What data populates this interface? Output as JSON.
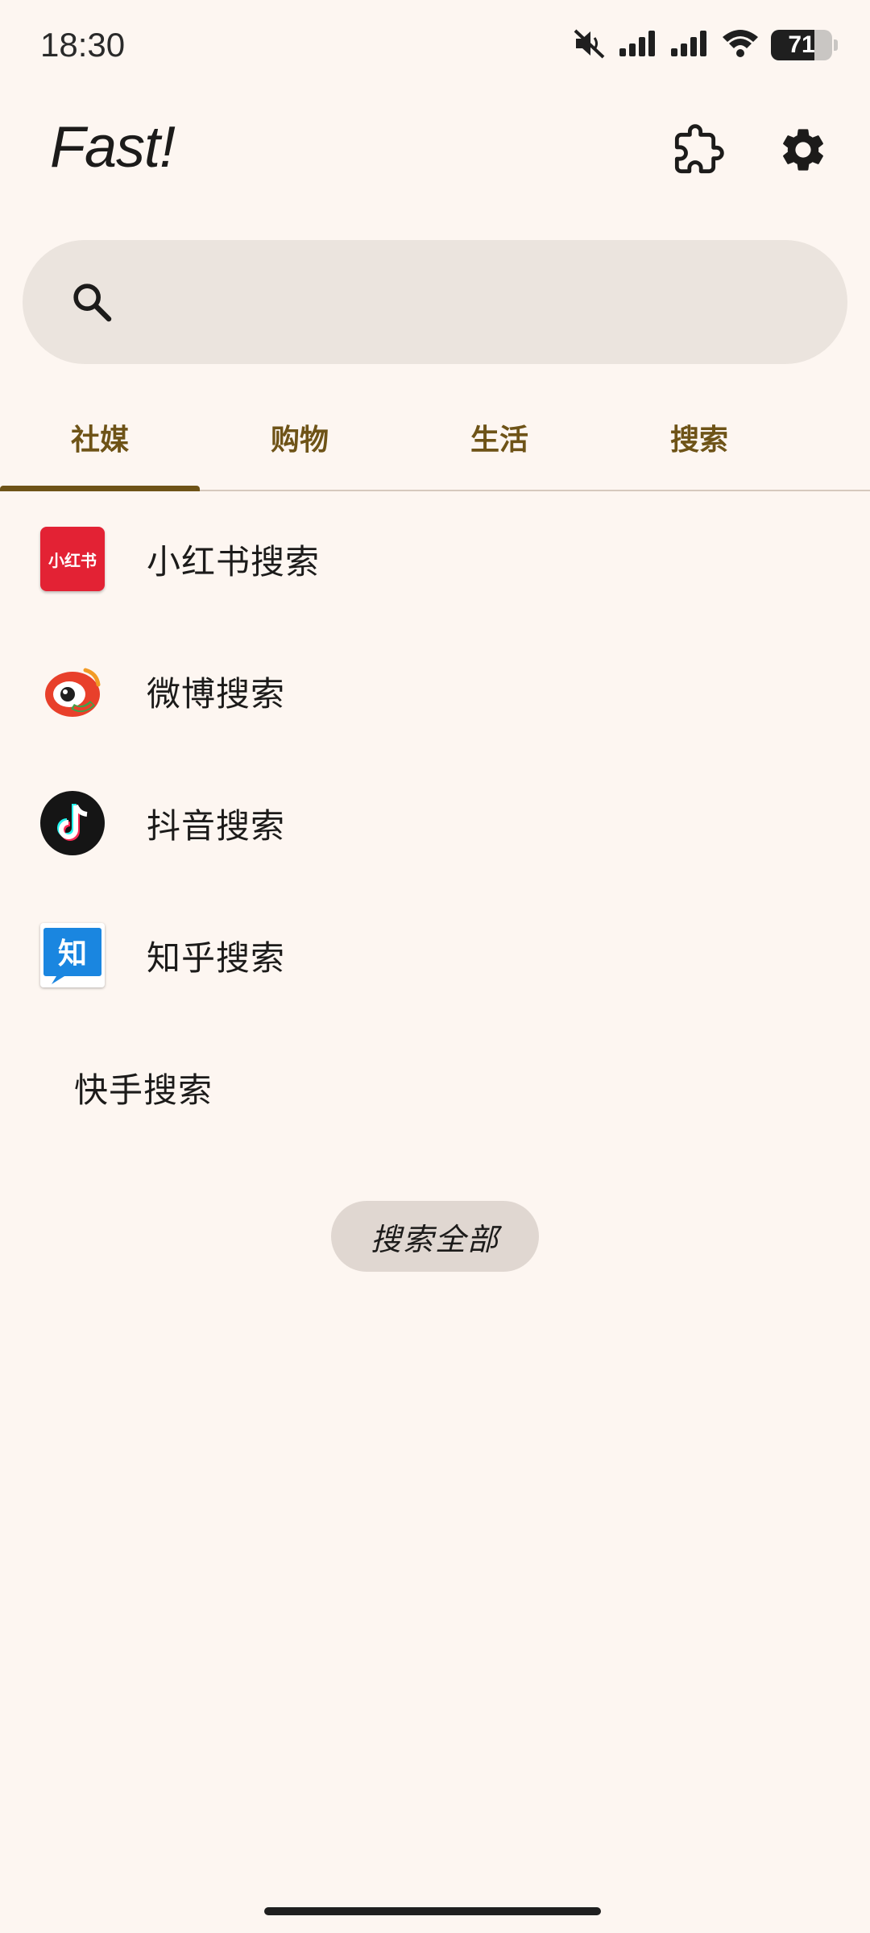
{
  "status_bar": {
    "time": "18:30",
    "battery_level": "71",
    "battery_fraction": 0.71,
    "icons": [
      "mute-icon",
      "signal-icon",
      "signal-icon",
      "wifi-icon",
      "battery-icon"
    ]
  },
  "header": {
    "title": "Fast!",
    "icons": [
      "puzzle-icon",
      "gear-icon"
    ]
  },
  "search": {
    "placeholder": "",
    "value": "",
    "icon": "search-icon"
  },
  "tabs": [
    {
      "label": "社媒",
      "active": true
    },
    {
      "label": "购物",
      "active": false
    },
    {
      "label": "生活",
      "active": false
    },
    {
      "label": "搜索",
      "active": false
    }
  ],
  "list": {
    "items": [
      {
        "label": "小红书搜索",
        "icon": "xiaohongshu-icon",
        "icon_text": "小红书"
      },
      {
        "label": "微博搜索",
        "icon": "weibo-icon"
      },
      {
        "label": "抖音搜索",
        "icon": "douyin-icon"
      },
      {
        "label": "知乎搜索",
        "icon": "zhihu-icon",
        "icon_text": "知"
      },
      {
        "label": "快手搜索",
        "icon": ""
      }
    ]
  },
  "actions": {
    "search_all_label": "搜索全部"
  },
  "colors": {
    "background": "#fdf6f1",
    "accent": "#6e5317",
    "search_bg": "#ebe4de",
    "button_bg": "#e0d7d1"
  }
}
